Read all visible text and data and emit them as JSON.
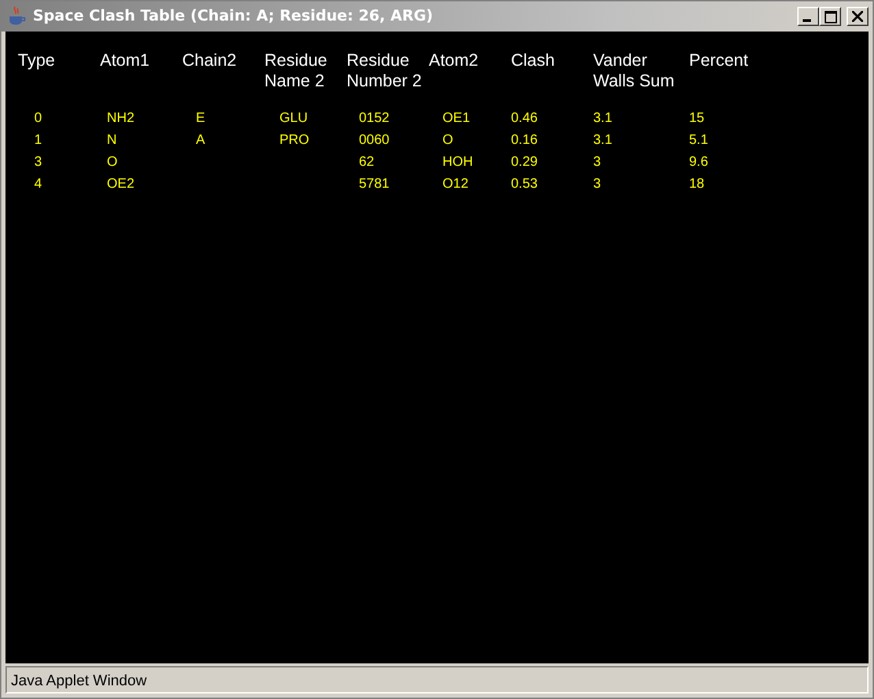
{
  "window": {
    "title": "Space Clash Table (Chain: A; Residue: 26, ARG)"
  },
  "table": {
    "columns": [
      "Type",
      "Atom1",
      "Chain2",
      "Residue Name 2",
      "Residue Number 2",
      "Atom2",
      "Clash",
      "Vander Walls Sum",
      "Percent"
    ],
    "rows": [
      [
        "0",
        "NH2",
        "E",
        "GLU",
        "0152",
        "OE1",
        "0.46",
        "3.1",
        "15"
      ],
      [
        "1",
        "N",
        "A",
        "PRO",
        "0060",
        "O",
        "0.16",
        "3.1",
        "5.1"
      ],
      [
        "3",
        "O",
        "",
        "",
        "62",
        "HOH",
        "0.29",
        "3",
        "9.6"
      ],
      [
        "4",
        "OE2",
        "",
        "",
        "5781",
        "O12",
        "0.53",
        "3",
        "18"
      ]
    ]
  },
  "status_bar": "Java Applet Window"
}
